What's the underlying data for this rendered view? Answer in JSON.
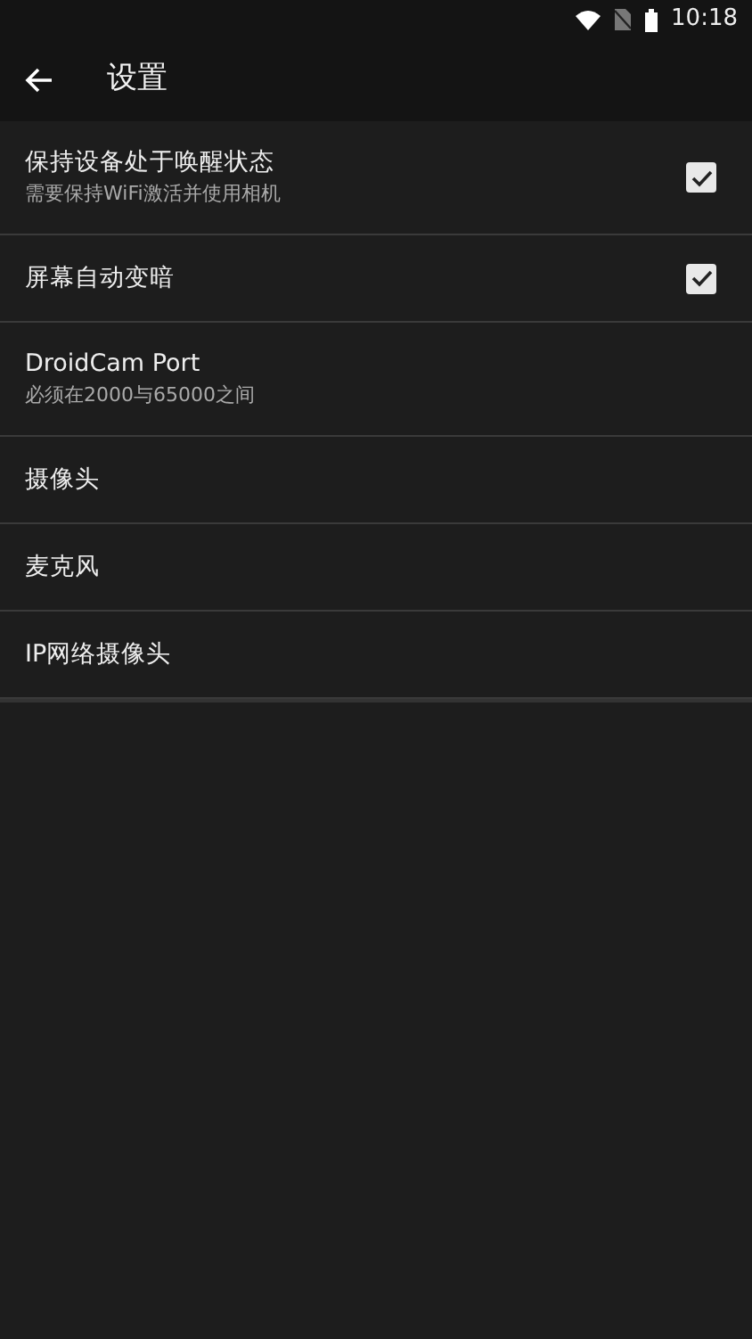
{
  "status_bar": {
    "time": "10:18"
  },
  "toolbar": {
    "title": "设置"
  },
  "settings": [
    {
      "kind": "checkbox",
      "title": "保持设备处于唤醒状态",
      "summary": "需要保持WiFi激活并使用相机",
      "checked": true
    },
    {
      "kind": "checkbox",
      "title": "屏幕自动变暗",
      "checked": true
    },
    {
      "kind": "plain",
      "title": "DroidCam Port",
      "summary": "必须在2000与65000之间"
    },
    {
      "kind": "plain",
      "title": "摄像头"
    },
    {
      "kind": "plain",
      "title": "麦克风"
    },
    {
      "kind": "plain",
      "title": "IP网络摄像头"
    }
  ]
}
